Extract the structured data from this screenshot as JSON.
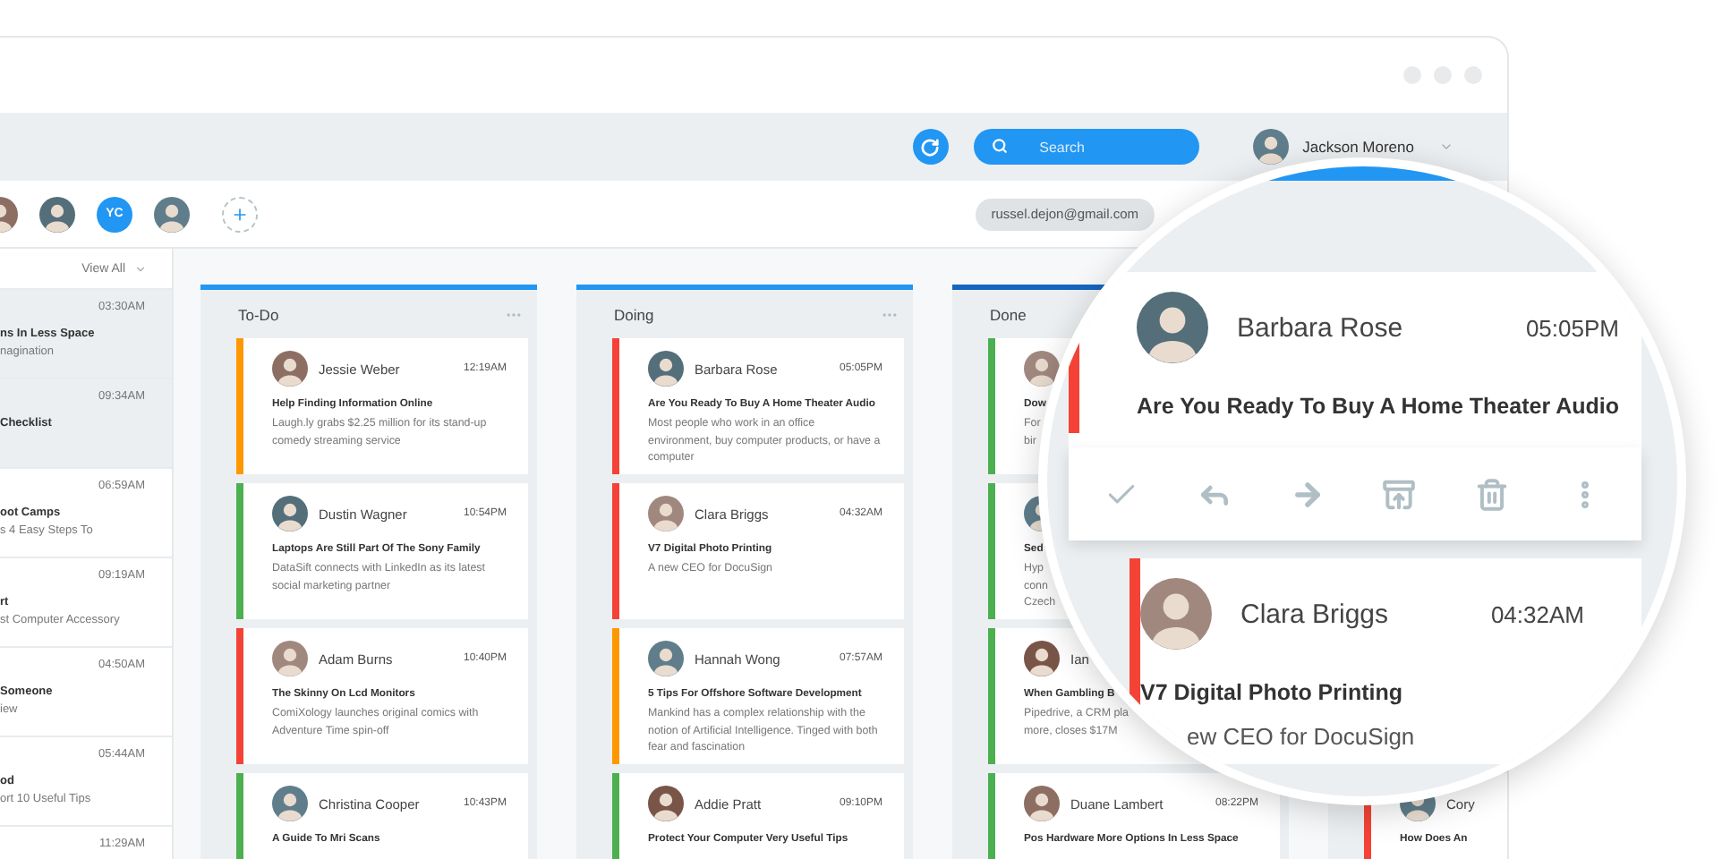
{
  "toolbar": {
    "search": {
      "placeholder": "Search"
    },
    "user": {
      "name": "Jackson Moreno"
    }
  },
  "members": [
    {
      "kind": "photo"
    },
    {
      "kind": "photo"
    },
    {
      "kind": "initials",
      "initials": "YC"
    },
    {
      "kind": "photo"
    }
  ],
  "email_chip": "russel.dejon@gmail.com",
  "inbox": {
    "filter": "View All",
    "items": [
      {
        "time": "03:30AM",
        "title": "ns In Less Space",
        "preview": [
          "nagination"
        ],
        "selected": true
      },
      {
        "time": "09:34AM",
        "title": "Checklist",
        "selected": true
      },
      {
        "time": "06:59AM",
        "title": "oot Camps",
        "preview": [
          "s 4 Easy Steps To"
        ],
        "selected": false
      },
      {
        "time": "09:19AM",
        "title": "rt",
        "preview": [
          "st Computer Accessory"
        ],
        "selected": false
      },
      {
        "time": "04:50AM",
        "title": "Someone",
        "preview": [
          "iew"
        ],
        "selected": false
      },
      {
        "time": "05:44AM",
        "title": "od",
        "preview": [
          "ort 10 Useful Tips"
        ],
        "selected": false
      },
      {
        "time": "11:29AM",
        "selected": false
      }
    ]
  },
  "board": {
    "columns": [
      {
        "title": "To-Do",
        "color": "#2196f3",
        "more": true,
        "cards": [
          {
            "name": "Jessie Weber",
            "time": "12:19AM",
            "title": "Help Finding Information Online",
            "body": [
              "Laugh.ly grabs $2.25 million for its stand-up",
              "comedy streaming service"
            ],
            "color": "#ff9800"
          },
          {
            "name": "Dustin Wagner",
            "time": "10:54PM",
            "title": "Laptops Are Still Part Of The Sony Family",
            "body": [
              "DataSift connects with LinkedIn as its latest",
              "social marketing partner"
            ],
            "color": "#4caf50"
          },
          {
            "name": "Adam Burns",
            "time": "10:40PM",
            "title": "The Skinny On Lcd Monitors",
            "body": [
              "ComiXology launches original comics with",
              "Adventure Time spin-off"
            ],
            "color": "#f44336"
          },
          {
            "name": "Christina Cooper",
            "time": "10:43PM",
            "title": "A Guide To Mri Scans",
            "color": "#4caf50"
          }
        ]
      },
      {
        "title": "Doing",
        "color": "#2196f3",
        "more": true,
        "cards": [
          {
            "name": "Barbara Rose",
            "time": "05:05PM",
            "title": "Are You Ready To Buy A Home Theater Audio",
            "body": [
              "Most people who work in an office",
              "environment, buy computer products, or have a",
              "computer"
            ],
            "color": "#f44336"
          },
          {
            "name": "Clara Briggs",
            "time": "04:32AM",
            "title": "V7 Digital Photo Printing",
            "body": [
              "A new CEO for DocuSign"
            ],
            "color": "#f44336"
          },
          {
            "name": "Hannah Wong",
            "time": "07:57AM",
            "title": "5 Tips For Offshore Software Development",
            "body": [
              "Mankind has a complex relationship with the",
              "notion of Artificial Intelligence. Tinged with both",
              "fear and fascination"
            ],
            "color": "#ff9800"
          },
          {
            "name": "Addie Pratt",
            "time": "09:10PM",
            "title": "Protect Your Computer Very Useful Tips",
            "color": "#4caf50"
          }
        ]
      },
      {
        "title": "Done",
        "color": "#1565c0",
        "cards": [
          {
            "title": "Dow",
            "body": [
              "For",
              "bir"
            ],
            "color": "#4caf50"
          },
          {
            "title": "Sed",
            "body": [
              "Hyp",
              "conn",
              "Czech"
            ],
            "color": "#4caf50"
          },
          {
            "name": "Ian",
            "title": "When Gambling B",
            "body": [
              "Pipedrive, a CRM pla",
              "more, closes $17M"
            ],
            "color": "#4caf50"
          },
          {
            "name": "Duane Lambert",
            "time": "08:22PM",
            "title": "Pos Hardware More Options In Less Space",
            "color": "#4caf50"
          }
        ]
      },
      {
        "cards": [
          {
            "name": "Cory",
            "title": "How Does An",
            "color": "#f44336"
          }
        ]
      }
    ]
  },
  "magnifier": {
    "cards": [
      {
        "name": "Barbara Rose",
        "time": "05:05PM",
        "title": "Are You Ready To Buy A Home Theater Audio",
        "color": "#f44336"
      },
      {
        "name": "Clara Briggs",
        "time": "04:32AM",
        "title": "V7 Digital Photo Printing",
        "body": "ew CEO for DocuSign",
        "color": "#f44336"
      }
    ]
  }
}
